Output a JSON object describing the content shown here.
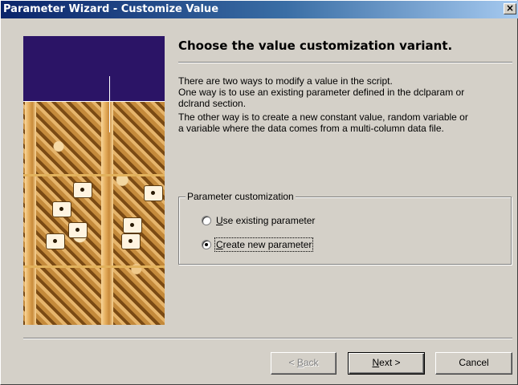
{
  "window": {
    "title": "Parameter Wizard - Customize Value",
    "close_glyph": "×"
  },
  "heading": "Choose the value customization variant.",
  "description": {
    "line1": "There are two ways to modify a value in the script.",
    "line2": "One way is to use an existing parameter defined in the dclparam or",
    "line3": "dclrand section.",
    "line4": "The other way is to create a new constant value, random variable or",
    "line5": "a variable where the data comes from a multi-column data file."
  },
  "group": {
    "legend": "Parameter customization",
    "options": [
      {
        "mnemonic": "U",
        "rest": "se existing parameter",
        "checked": false
      },
      {
        "mnemonic": "C",
        "rest": "reate new parameter",
        "checked": true
      }
    ]
  },
  "buttons": {
    "back": {
      "prefix": "< ",
      "mnemonic": "B",
      "rest": "ack",
      "enabled": false
    },
    "next": {
      "mnemonic": "N",
      "rest": "ext >",
      "enabled": true
    },
    "cancel": {
      "label": "Cancel",
      "enabled": true
    }
  },
  "colors": {
    "dialog_face": "#d4d0c8",
    "titlebar_start": "#0a246a",
    "titlebar_end": "#a6caf0",
    "image_band": "#2b1466"
  },
  "icons": {
    "close": "close-icon",
    "radio": "radio-button"
  }
}
